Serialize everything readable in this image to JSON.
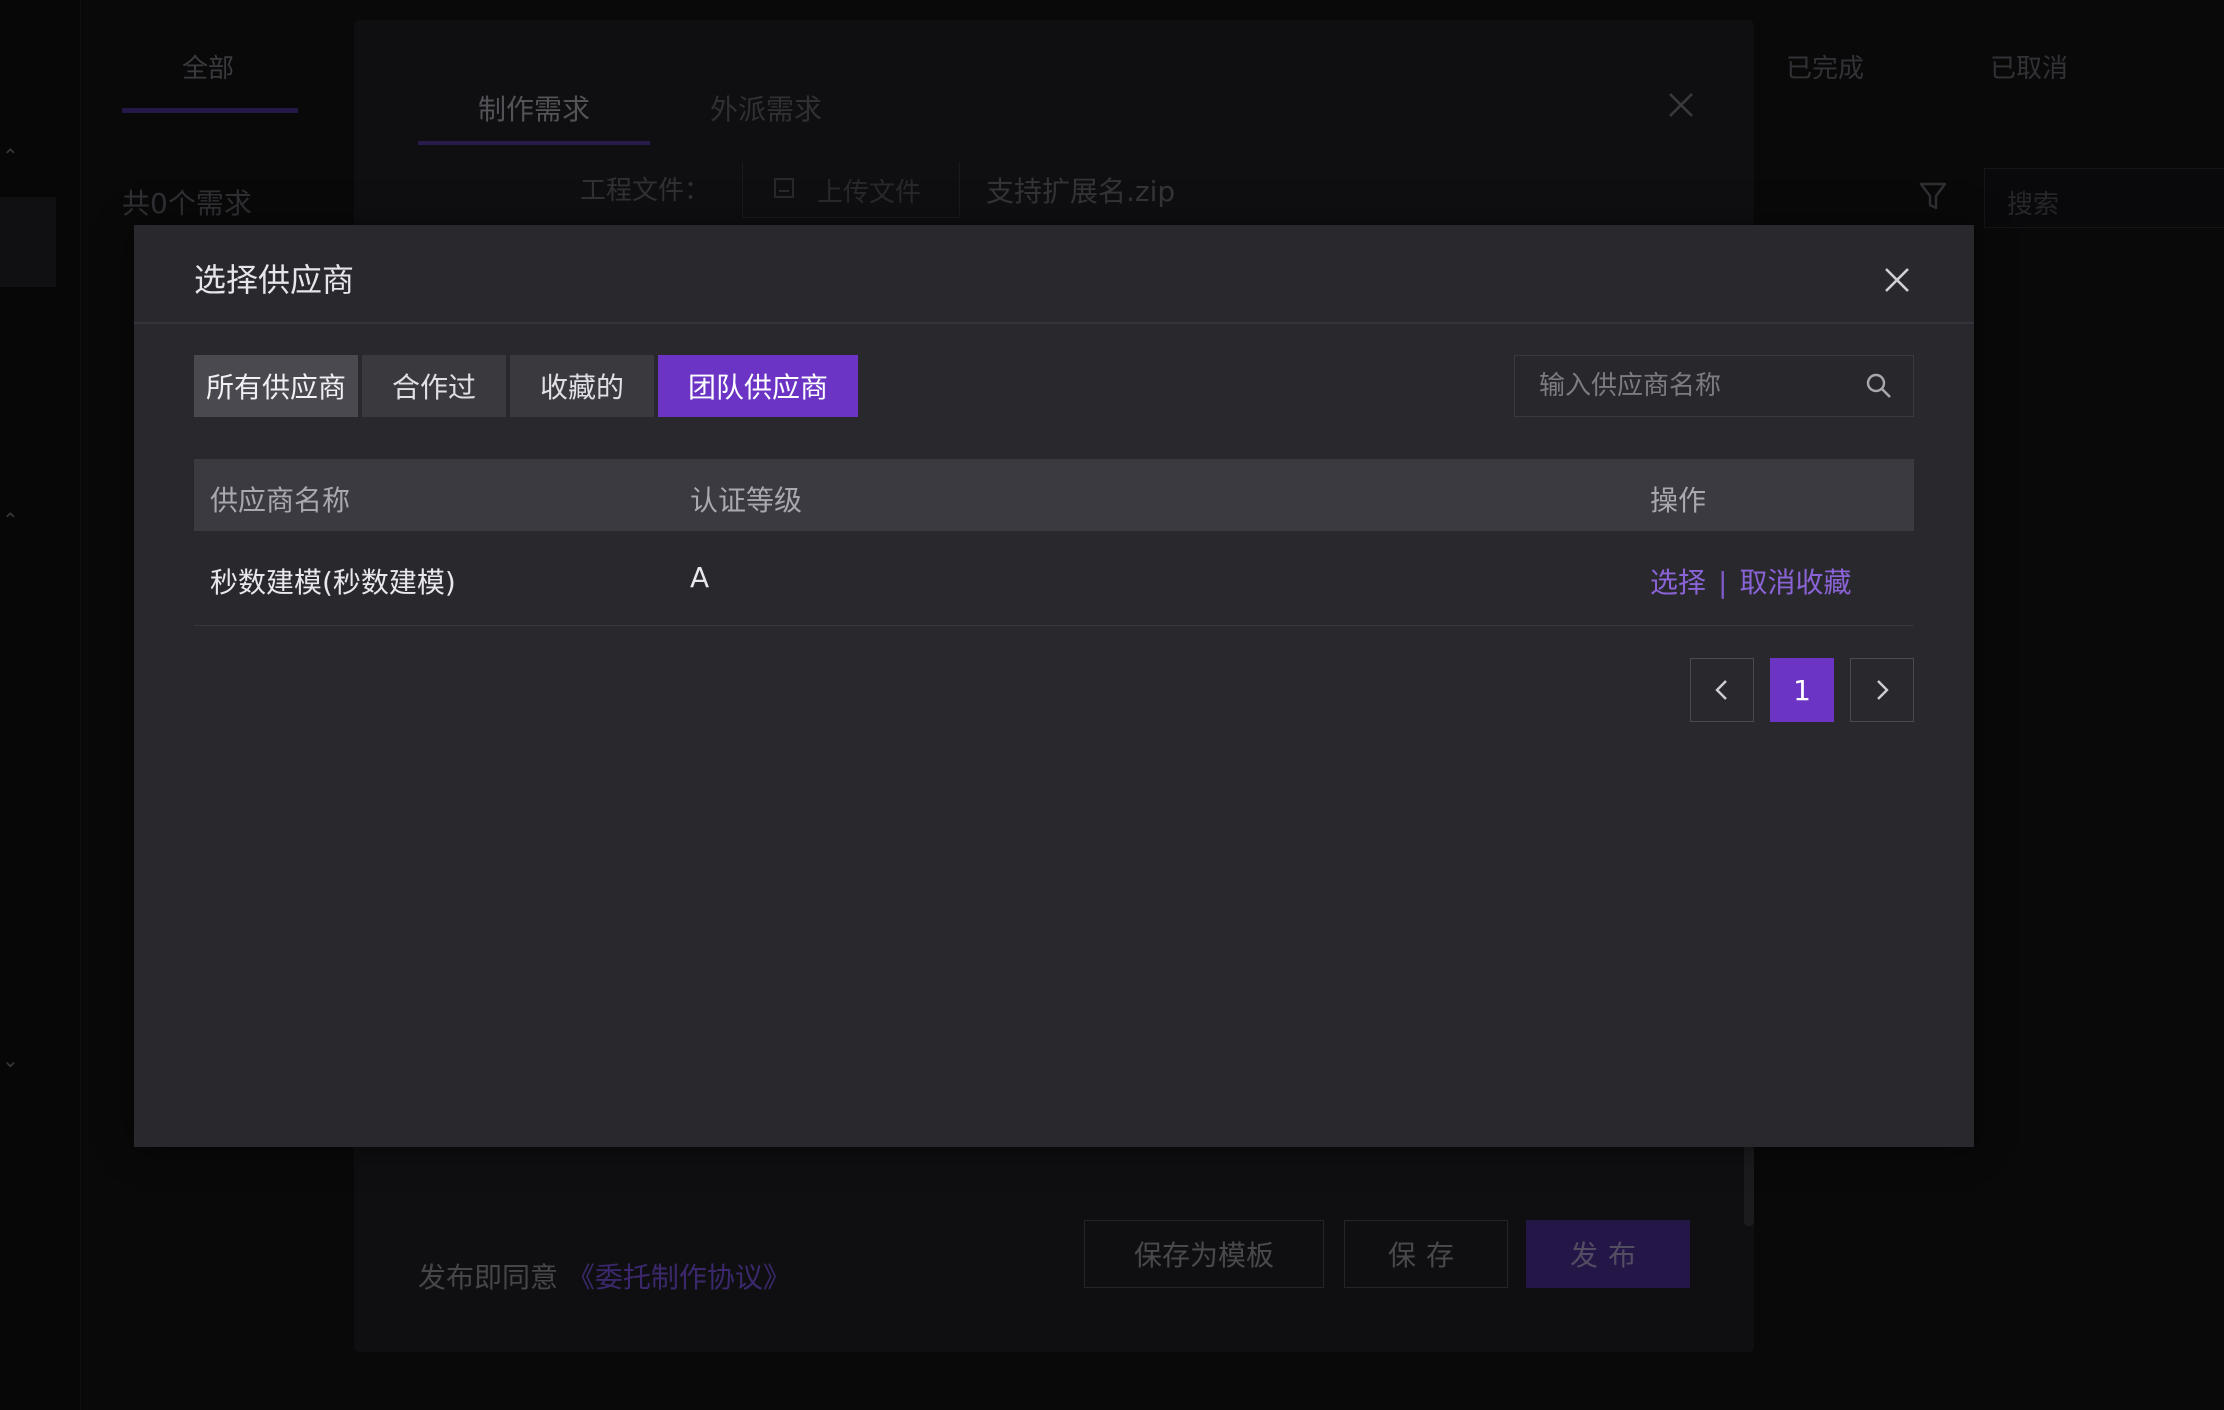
{
  "background": {
    "tabs": [
      "全部",
      "已完成",
      "已取消"
    ],
    "count_text": "共0个需求",
    "search_placeholder": "搜索"
  },
  "middle_dialog": {
    "tabs": [
      "制作需求",
      "外派需求"
    ],
    "file_label": "工程文件：",
    "upload_label": "上传文件",
    "extension_hint": "支持扩展名.zip",
    "agree_text": "发布即同意",
    "agree_link": "《委托制作协议》",
    "buttons": {
      "save_template": "保存为模板",
      "save": "保存",
      "publish": "发布"
    }
  },
  "supplier_dialog": {
    "title": "选择供应商",
    "tabs": [
      {
        "label": "所有供应商",
        "active": false
      },
      {
        "label": "合作过",
        "active": false
      },
      {
        "label": "收藏的",
        "active": false
      },
      {
        "label": "团队供应商",
        "active": true
      }
    ],
    "search_placeholder": "输入供应商名称",
    "table": {
      "headers": [
        "供应商名称",
        "认证等级",
        "操作"
      ],
      "rows": [
        {
          "name": "秒数建模(秒数建模)",
          "level": "A",
          "actions": [
            "选择",
            "取消收藏"
          ],
          "separator": "|"
        }
      ]
    },
    "pagination": {
      "current": "1",
      "pages": [
        "1"
      ]
    }
  },
  "colors": {
    "accent": "#6b34c4",
    "link": "#8a63d6",
    "dialog_bg": "#29282c"
  }
}
